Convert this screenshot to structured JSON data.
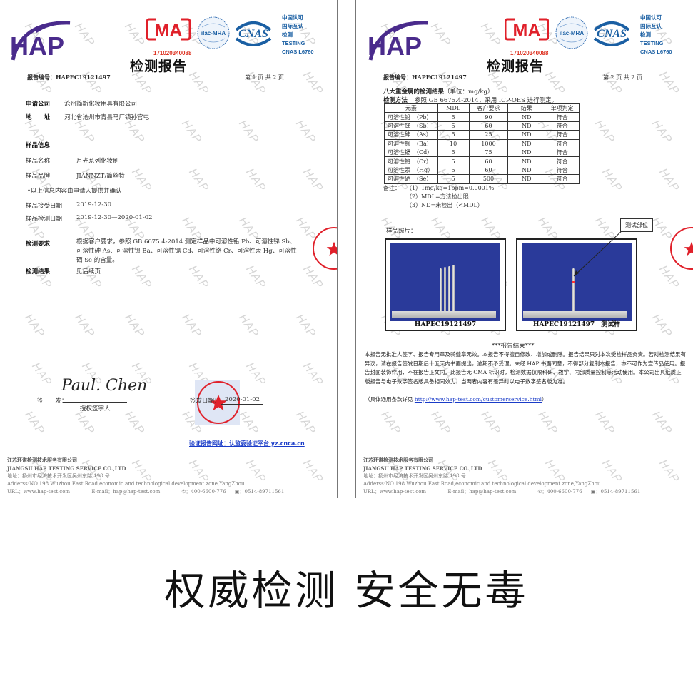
{
  "pages": [
    {
      "logo": "HAP",
      "cma_number": "171020340088",
      "cert_logos": [
        "MA",
        "ilac-MRA",
        "CNAS"
      ],
      "cnas_text": [
        "中国认可",
        "国际互认",
        "检测",
        "TESTING",
        "CNAS L6760"
      ],
      "title": "检测报告",
      "report_no_label": "报告编号：",
      "report_no": "HAPEC19121497",
      "page_no": "第 1 页 共 2 页",
      "applicant_label": "申请公司",
      "applicant": "沧州简斯化妆用具有限公司",
      "address_label": "地　　址",
      "address": "河北省沧州市青县马厂镇孙官屯",
      "sample_info_label": "样品信息",
      "sample_name_label": "样品名称",
      "sample_name": "月光系列化妆刷",
      "sample_brand_label": "样品品牌",
      "sample_brand": "JIANNZT/简丝特",
      "note": "•以上信息内容由申请人提供并确认",
      "received_date_label": "样品接受日期",
      "received_date": "2019-12-30",
      "test_date_label": "样品检测日期",
      "test_date": "2019-12-30—2020-01-02",
      "requirement_label": "检测要求",
      "requirement": "根据客户要求，参照 GB 6675.4-2014 测定样品中可溶性铅 Pb、可溶性锑 Sb、可溶性砷 As、可溶性钡 Ba、可溶性镉 Cd、可溶性铬 Cr、可溶性汞 Hg、可溶性硒 Se 的含量。",
      "result_label": "检测结果",
      "result": "见后续页",
      "signer_label": "签　　发：",
      "signature": "Paul. Chen",
      "signer_title": "授权签字人",
      "sign_date_label": "签发日期：",
      "sign_date": "2020-01-02",
      "verify_link": "验证报告网址：认监委验证平台 yz.cnca.cn"
    },
    {
      "logo": "HAP",
      "cma_number": "171020340088",
      "cert_logos": [
        "MA",
        "ilac-MRA",
        "CNAS"
      ],
      "cnas_text": [
        "中国认可",
        "国际互认",
        "检测",
        "TESTING",
        "CNAS L6760"
      ],
      "title": "检测报告",
      "report_no_label": "报告编号：",
      "report_no": "HAPEC19121497",
      "page_no": "第 2 页 共 2 页",
      "results_heading": "八大重金属的检测结果",
      "results_unit": "（单位：mg/kg）",
      "method_label": "检测方法",
      "method": "参照 GB 6675.4-2014，采用 ICP-OES 进行测定。",
      "table": {
        "headers": [
          "元素",
          "MDL",
          "客户要求",
          "结果",
          "单项判定"
        ],
        "rows": [
          [
            "可溶性铅　（Pb）",
            "5",
            "90",
            "ND",
            "符合"
          ],
          [
            "可溶性锑　（Sb）",
            "5",
            "60",
            "ND",
            "符合"
          ],
          [
            "可溶性砷　（As）",
            "5",
            "25",
            "ND",
            "符合"
          ],
          [
            "可溶性钡　（Ba）",
            "10",
            "1000",
            "ND",
            "符合"
          ],
          [
            "可溶性镉　（Cd）",
            "5",
            "75",
            "ND",
            "符合"
          ],
          [
            "可溶性铬　（Cr）",
            "5",
            "60",
            "ND",
            "符合"
          ],
          [
            "可溶性汞　（Hg）",
            "5",
            "60",
            "ND",
            "符合"
          ],
          [
            "可溶性硒　（Se）",
            "5",
            "500",
            "ND",
            "符合"
          ]
        ]
      },
      "notes_label": "备注：",
      "notes": [
        "（1）1mg/kg=1ppm=0.0001%",
        "（2）MDL=方法检出限",
        "（3）ND=未检出（<MDL）"
      ],
      "photo_label": "样品照片：",
      "photo_captions": [
        "HAPEC19121497",
        "HAPEC19121497　测试样"
      ],
      "callout": "测试部位",
      "end_marker": "***报告结束***",
      "disclaimer": "本报告无批准人签字、报告专用章及骑缝章无效。本报告不得擅自修改、增加或删除。报告结果只对本次受检样品负责。若对检测结果有异议，请在报告签发日期后十五天内书面提出，逾期不予受理。未经 HAP 书面同意，不得部分复制本报告，亦不可作为宣传品使用。报告封面装饰作用，不在报告正文内。此报告无 CMA 标识时，检测数据仅限科研、教学、内部质量控制等活动使用。本公司出具纸质正版报告与电子数字签名版具备相同效力，当两者内容有差异时以电子数字签名版为准。",
      "terms_prefix": "（具体通用条款详见 ",
      "terms_link": "http://www.hap-test.com/customerservice.html",
      "terms_suffix": "）"
    }
  ],
  "footer": {
    "company_cn": "江苏环谱检测技术服务有限公司",
    "company_en": "JIANGSU HAP TESTING SERVICE CO.,LTD",
    "address_cn": "地址：扬州市经济技术开发区吴州东路 198 号",
    "address_en": "Adderss:NO.198 Wuzhou East Road,economic and technological development zone,YangZhou",
    "url": "URL：www.hap-test.com",
    "email": "E-mail：hap@hap-test.com",
    "phone": "：400-6600-776",
    "fax": "：0514-89711561"
  },
  "watermark": "HAP",
  "slogan": "权威检测 安全无毒",
  "colors": {
    "hap_purple": "#4a2b8c",
    "ma_red": "#e0202a",
    "cnas_blue": "#1a5fa3",
    "link_blue": "#1a3cc8",
    "photo_bg": "#2a3a9a"
  }
}
